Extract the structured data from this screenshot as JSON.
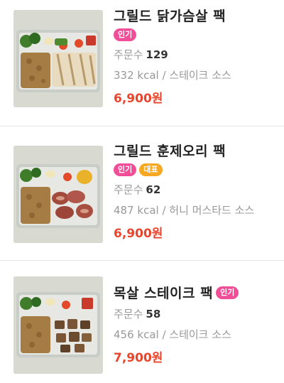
{
  "products": [
    {
      "title": "그릴드 닭가슴살 팩",
      "badges": [
        {
          "label": "인기",
          "color": "#f04e98"
        }
      ],
      "orders_label": "주문수",
      "orders": "129",
      "desc": "332 kcal / 스테이크 소스",
      "price": "6,900원",
      "image": "grilled-chicken-meal-box"
    },
    {
      "title": "그릴드 훈제오리 팩",
      "badges": [
        {
          "label": "인기",
          "color": "#f04e98"
        },
        {
          "label": "대표",
          "color": "#f7a823"
        }
      ],
      "orders_label": "주문수",
      "orders": "62",
      "desc": "487 kcal / 허니 머스타드 소스",
      "price": "6,900원",
      "image": "smoked-duck-meal-box"
    },
    {
      "title": "목살 스테이크 팩",
      "badges": [
        {
          "label": "인기",
          "color": "#f04e98"
        }
      ],
      "orders_label": "주문수",
      "orders": "58",
      "desc": "456 kcal / 스테이크 소스",
      "price": "7,900원",
      "image": "pork-neck-steak-meal-box"
    }
  ],
  "colors": {
    "price": "#e8452c",
    "badge_hot": "#f04e98",
    "badge_rep": "#f7a823"
  }
}
